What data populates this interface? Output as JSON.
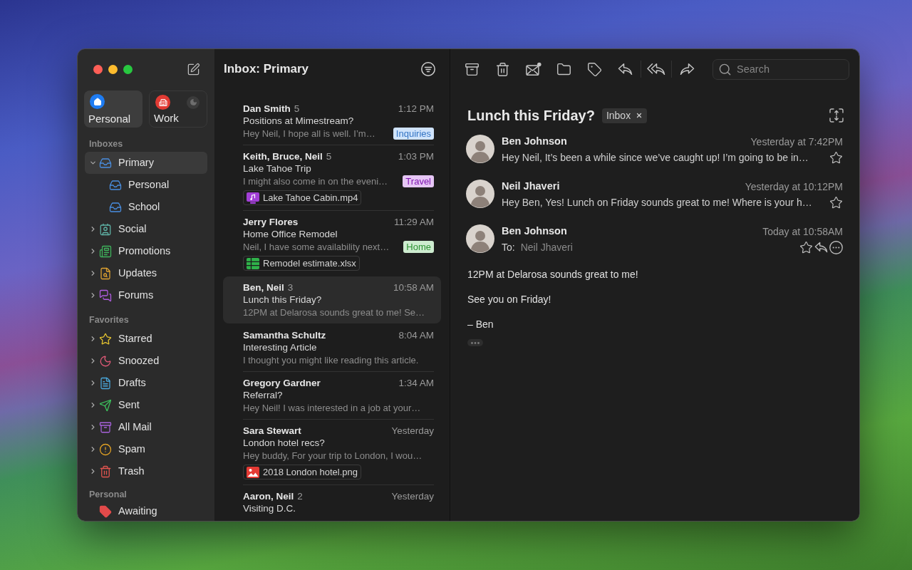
{
  "accounts": [
    {
      "label": "Personal",
      "selected": true,
      "muted": false
    },
    {
      "label": "Work",
      "selected": false,
      "muted": true
    }
  ],
  "sidebar": {
    "sections": [
      {
        "title": "Inboxes",
        "items": [
          {
            "label": "Primary",
            "selected": true,
            "expanded": true,
            "children": [
              {
                "label": "Personal",
                "selected": false
              },
              {
                "label": "School",
                "selected": false
              }
            ]
          },
          {
            "label": "Social",
            "selected": false,
            "expanded": false
          },
          {
            "label": "Promotions",
            "selected": false,
            "expanded": false
          },
          {
            "label": "Updates",
            "selected": false,
            "expanded": false
          },
          {
            "label": "Forums",
            "selected": false,
            "expanded": false
          }
        ]
      },
      {
        "title": "Favorites",
        "items": [
          {
            "label": "Starred",
            "selected": false,
            "expanded": false
          },
          {
            "label": "Snoozed",
            "selected": false,
            "expanded": false
          },
          {
            "label": "Drafts",
            "selected": false,
            "expanded": false
          },
          {
            "label": "Sent",
            "selected": false,
            "expanded": false
          },
          {
            "label": "All Mail",
            "selected": false,
            "expanded": false
          },
          {
            "label": "Spam",
            "selected": false,
            "expanded": false
          },
          {
            "label": "Trash",
            "selected": false,
            "expanded": false
          }
        ]
      },
      {
        "title": "Personal",
        "items": [
          {
            "label": "Awaiting",
            "selected": false
          }
        ]
      }
    ]
  },
  "message_list": {
    "title": "Inbox: Primary",
    "messages": [
      {
        "sender": "Dan Smith",
        "count": "5",
        "time": "1:12 PM",
        "subject": "Positions at Mimestream?",
        "preview": "Hey Neil, I hope all is well. I’m…",
        "tag": {
          "label": "Inquiries",
          "color": "#cfe3fb"
        },
        "selected": false
      },
      {
        "sender": "Keith, Bruce, Neil",
        "count": "5",
        "time": "1:03 PM",
        "subject": "Lake Tahoe Trip",
        "preview": "I might also come in on the eveni…",
        "tag": {
          "label": "Travel",
          "color": "#e6c6f5"
        },
        "attachment": {
          "kind": "video",
          "name": "Lake Tahoe Cabin.mp4"
        },
        "selected": false
      },
      {
        "sender": "Jerry Flores",
        "time": "11:29 AM",
        "subject": "Home Office Remodel",
        "preview": "Neil, I have some availability next…",
        "tag": {
          "label": "Home",
          "color": "#cdeccf"
        },
        "attachment": {
          "kind": "spreadsheet",
          "name": "Remodel estimate.xlsx"
        },
        "selected": false
      },
      {
        "sender": "Ben, Neil",
        "count": "3",
        "time": "10:58 AM",
        "subject": "Lunch this Friday?",
        "preview": "12PM at Delarosa sounds great to me! Se…",
        "selected": true
      },
      {
        "sender": "Samantha Schultz",
        "time": "8:04 AM",
        "subject": "Interesting Article",
        "preview": "I thought you might like reading this article.",
        "selected": false
      },
      {
        "sender": "Gregory Gardner",
        "time": "1:34 AM",
        "subject": "Referral?",
        "preview": "Hey Neil! I was interested in a job at your…",
        "selected": false
      },
      {
        "sender": "Sara Stewart",
        "time": "Yesterday",
        "subject": "London hotel recs?",
        "preview": "Hey buddy, For your trip to London, I wou…",
        "attachment": {
          "kind": "image",
          "name": "2018 London hotel.png"
        },
        "selected": false
      },
      {
        "sender": "Aaron, Neil",
        "count": "2",
        "time": "Yesterday",
        "subject": "Visiting D.C.",
        "selected": false
      }
    ]
  },
  "reader": {
    "search": {
      "placeholder": "Search"
    },
    "subject": "Lunch this Friday?",
    "label_chip": "Inbox",
    "thread": [
      {
        "kind": "collapsed",
        "sender": "Ben Johnson",
        "time": "Yesterday at 7:42PM",
        "preview": "Hey Neil, It’s been a while since we’ve caught up! I’m going to be in…",
        "starred": false
      },
      {
        "kind": "collapsed",
        "sender": "Neil Jhaveri",
        "time": "Yesterday at 10:12PM",
        "preview": "Hey Ben, Yes! Lunch on Friday sounds great to me! Where is your h…",
        "starred": false
      },
      {
        "kind": "expanded",
        "sender": "Ben Johnson",
        "time": "Today at 10:58AM",
        "to_label": "To:",
        "to": "Neil Jhaveri",
        "starred": false,
        "body": [
          "12PM at Delarosa sounds great to me!",
          "See you on Friday!",
          "– Ben"
        ]
      }
    ]
  }
}
